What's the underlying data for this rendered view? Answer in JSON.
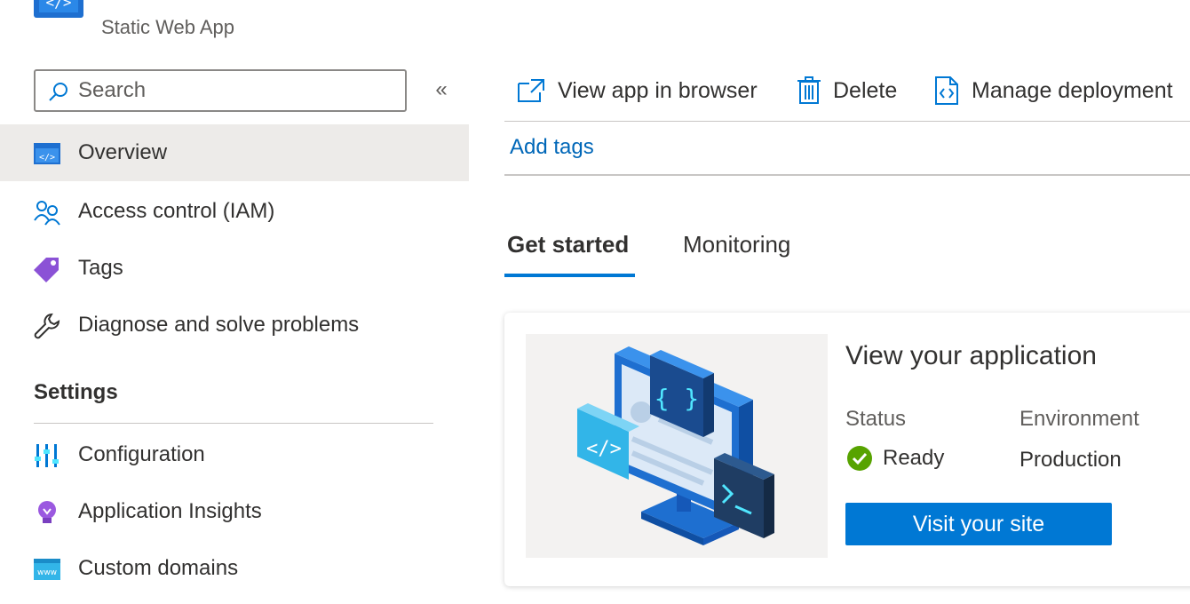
{
  "header": {
    "subtitle": "Static Web App"
  },
  "sidebar": {
    "search": {
      "placeholder": "Search",
      "value": ""
    },
    "collapse_glyph": "«",
    "items": [
      {
        "label": "Overview",
        "icon": "overview-icon",
        "selected": true
      },
      {
        "label": "Access control (IAM)",
        "icon": "people-icon"
      },
      {
        "label": "Tags",
        "icon": "tag-icon"
      },
      {
        "label": "Diagnose and solve problems",
        "icon": "wrench-icon"
      }
    ],
    "settings_header": "Settings",
    "settings_items": [
      {
        "label": "Configuration",
        "icon": "sliders-icon"
      },
      {
        "label": "Application Insights",
        "icon": "lightbulb-icon"
      },
      {
        "label": "Custom domains",
        "icon": "www-icon"
      }
    ]
  },
  "toolbar": {
    "view_app": "View app in browser",
    "delete": "Delete",
    "manage_deployment": "Manage deployment"
  },
  "tags": {
    "add_label": "Add tags"
  },
  "tabs": [
    {
      "label": "Get started",
      "active": true
    },
    {
      "label": "Monitoring",
      "active": false
    }
  ],
  "card": {
    "title": "View your application",
    "status_label": "Status",
    "status_value": "Ready",
    "environment_label": "Environment",
    "environment_value": "Production",
    "visit_button": "Visit your site"
  },
  "colors": {
    "accent": "#0078d4",
    "link": "#0067b8",
    "success": "#57a300",
    "selected_bg": "#edebe9"
  }
}
